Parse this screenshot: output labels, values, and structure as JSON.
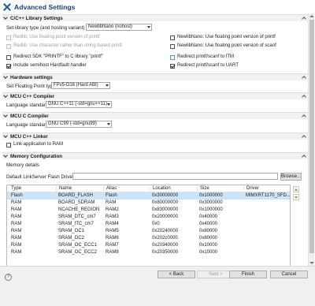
{
  "window": {
    "title": "Advanced Settings"
  },
  "sections": {
    "c_library": {
      "title": "C/C++ Library Settings",
      "library_label": "Set library type (and hosting variant)",
      "library_value": "NewlibNano (nohost)",
      "options": [
        {
          "label": "Redlib: Use floating point version of printf",
          "checked": false,
          "disabled": true
        },
        {
          "label": "NewlibNano: Use floating point version of printf",
          "checked": false,
          "disabled": false
        },
        {
          "label": "Redlib: Use character rather than string based printf",
          "checked": false,
          "disabled": true
        },
        {
          "label": "NewlibNano: Use floating point version of scanf",
          "checked": false,
          "disabled": false
        },
        {
          "label": "Redirect SDK \"PRINTF\" to C library \"printf\"",
          "checked": false,
          "disabled": false
        },
        {
          "label": "Redirect printf/scanf to ITM",
          "checked": false,
          "disabled": false
        },
        {
          "label": "Include semihost Hardfault handler",
          "checked": true,
          "disabled": false
        },
        {
          "label": "Redirect printf/scanf to UART",
          "checked": true,
          "disabled": false
        }
      ]
    },
    "hardware": {
      "title": "Hardware settings",
      "fp_label": "Set Floating Point type",
      "fp_value": "FPv5-D16 (Hard ABI)"
    },
    "mcu_cpp_compiler": {
      "title": "MCU C++ Compiler",
      "std_label": "Language standard",
      "std_value": "GNU C++11 (-std=gnu++11)"
    },
    "mcu_c_compiler": {
      "title": "MCU C Compiler",
      "std_label": "Language standard",
      "std_value": "GNU C99 (-std=gnu99)"
    },
    "mcu_cpp_linker": {
      "title": "MCU C++ Linker",
      "link_ram_label": "Link application to RAM",
      "link_ram_checked": false
    },
    "memory": {
      "title": "Memory Configuration",
      "details_label": "Memory details",
      "flash_driver_label": "Default LinkServer Flash Driver",
      "flash_driver_value": "",
      "browse_label": "Browse...",
      "columns": [
        "Type",
        "Name",
        "Alias",
        "Location",
        "Size",
        "Driver"
      ],
      "rows": [
        {
          "type": "Flash",
          "name": "BOARD_FLASH",
          "alias": "Flash",
          "location": "0x30000000",
          "size": "0x1000000",
          "driver": "MIMXRT1170_SFD...",
          "selected": true
        },
        {
          "type": "RAM",
          "name": "BOARD_SDRAM",
          "alias": "RAM",
          "location": "0x80000000",
          "size": "0x3000000",
          "driver": "",
          "selected": false
        },
        {
          "type": "RAM",
          "name": "NCACHE_REGION",
          "alias": "RAM2",
          "location": "0x83000000",
          "size": "0x1000000",
          "driver": "",
          "selected": false
        },
        {
          "type": "RAM",
          "name": "SRAM_DTC_cm7",
          "alias": "RAM3",
          "location": "0x20000000",
          "size": "0x40000",
          "driver": "",
          "selected": false
        },
        {
          "type": "RAM",
          "name": "SRAM_ITC_cm7",
          "alias": "RAM4",
          "location": "0x0",
          "size": "0x40000",
          "driver": "",
          "selected": false
        },
        {
          "type": "RAM",
          "name": "SRAM_OC1",
          "alias": "RAM5",
          "location": "0x20240000",
          "size": "0x80000",
          "driver": "",
          "selected": false
        },
        {
          "type": "RAM",
          "name": "SRAM_OC2",
          "alias": "RAM6",
          "location": "0x202c0000",
          "size": "0x80000",
          "driver": "",
          "selected": false
        },
        {
          "type": "RAM",
          "name": "SRAM_OC_ECC1",
          "alias": "RAM7",
          "location": "0x20340000",
          "size": "0x10000",
          "driver": "",
          "selected": false
        },
        {
          "type": "RAM",
          "name": "SRAM_OC_ECC2",
          "alias": "RAM8",
          "location": "0x20350000",
          "size": "0x10000",
          "driver": "",
          "selected": false
        }
      ]
    }
  },
  "buttons": {
    "help": "?",
    "back": "< Back",
    "next": "Next >",
    "finish": "Finish",
    "cancel": "Cancel"
  },
  "icons": [
    "app-logo-icon",
    "chevron-down-icon",
    "collapse-icon",
    "dropdown-arrow-icon",
    "move-up-icon",
    "move-down-icon",
    "help-icon"
  ],
  "colors": {
    "title": "#1b3f7a",
    "selected_row": "#cce4f7",
    "accent": "#1b5aa8"
  }
}
